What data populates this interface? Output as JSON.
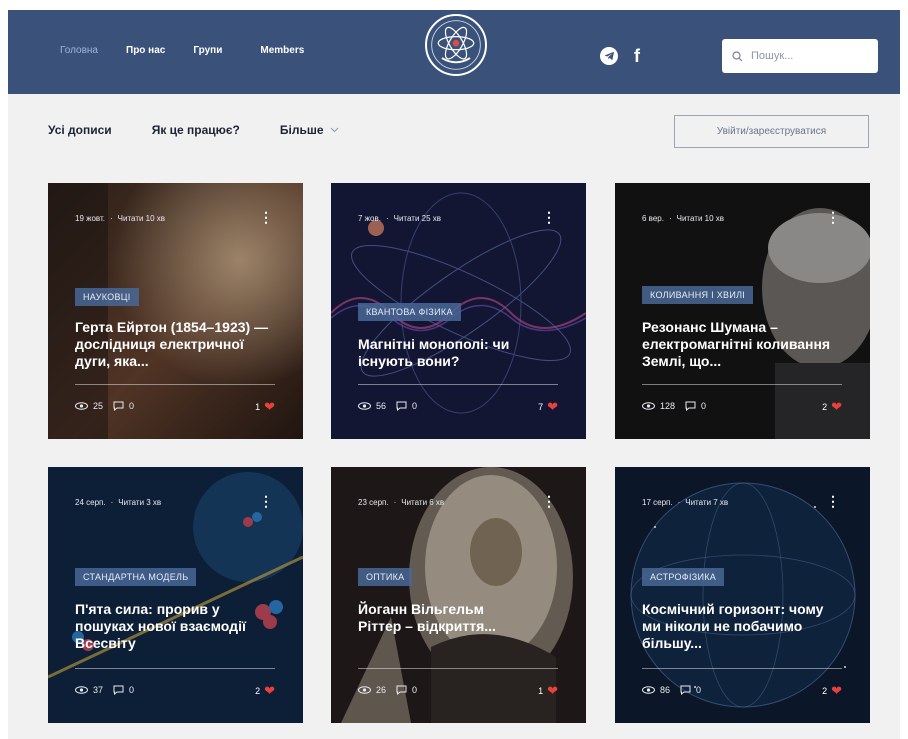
{
  "header": {
    "nav": [
      "Головна",
      "Про нас",
      "Групи",
      "Members"
    ],
    "search_placeholder": "Пошук..."
  },
  "subnav": {
    "items": [
      "Усі дописи",
      "Як це працює?"
    ],
    "more_label": "Більше",
    "login_label": "Увійти/зареєструватися"
  },
  "colors": {
    "header_bg": "#3a5179",
    "tag_bg": "#496796",
    "heart": "#e8413c",
    "page_bg": "#f1f1f2"
  },
  "icons": [
    "telegram-icon",
    "facebook-icon",
    "search-icon",
    "chevron-down-icon",
    "eye-icon",
    "comment-icon",
    "heart-icon",
    "more-vertical-icon"
  ],
  "posts": [
    {
      "date": "19 жовт.",
      "read": "Читати 10 хв",
      "tag": "НАУКОВЦІ",
      "title": "Герта Ейртон (1854–1923) — дослідниця електричної дуги, яка...",
      "views": "25",
      "comments": "0",
      "likes": "1"
    },
    {
      "date": "7 жов.",
      "read": "Читати 25 хв",
      "tag": "КВАНТОВА ФІЗИКА",
      "title": "Магнітні монополі: чи існують вони?",
      "views": "56",
      "comments": "0",
      "likes": "7"
    },
    {
      "date": "6 вер.",
      "read": "Читати 10 хв",
      "tag": "КОЛИВАННЯ І ХВИЛІ",
      "title": "Резонанс Шумана – електромагнітні коливання Землі, що...",
      "views": "128",
      "comments": "0",
      "likes": "2"
    },
    {
      "date": "24 серп.",
      "read": "Читати 3 хв",
      "tag": "СТАНДАРТНА МОДЕЛЬ",
      "title": "П'ята сила: прорив у пошуках нової взаємодії Всесвіту",
      "views": "37",
      "comments": "0",
      "likes": "2"
    },
    {
      "date": "23 серп.",
      "read": "Читати 6 хв",
      "tag": "ОПТИКА",
      "title": "Йоганн Вільгельм Ріттер – відкриття...",
      "views": "26",
      "comments": "0",
      "likes": "1"
    },
    {
      "date": "17 серп.",
      "read": "Читати 7 хв",
      "tag": "АСТРОФІЗИКА",
      "title": "Космічний горизонт: чому ми ніколи не побачимо більшу...",
      "views": "86",
      "comments": "0",
      "likes": "2"
    }
  ]
}
